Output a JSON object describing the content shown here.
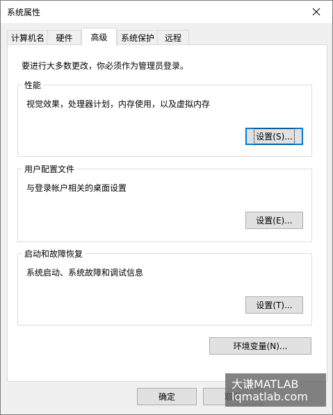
{
  "window": {
    "title": "系统属性"
  },
  "tabs": [
    {
      "label": "计算机名"
    },
    {
      "label": "硬件"
    },
    {
      "label": "高级"
    },
    {
      "label": "系统保护"
    },
    {
      "label": "远程"
    }
  ],
  "panel": {
    "intro": "要进行大多数更改，你必须作为管理员登录。",
    "performance": {
      "title": "性能",
      "desc": "视觉效果，处理器计划，内存使用，以及虚拟内存",
      "button": "设置(S)..."
    },
    "profiles": {
      "title": "用户配置文件",
      "desc": "与登录帐户相关的桌面设置",
      "button": "设置(E)..."
    },
    "startup": {
      "title": "启动和故障恢复",
      "desc": "系统启动、系统故障和调试信息",
      "button": "设置(T)..."
    },
    "env_button": "环境变量(N)..."
  },
  "footer": {
    "ok": "确定",
    "cancel": "取消"
  },
  "watermark": {
    "line1": "大谦MATLAB",
    "line2": "lqmatlab.com"
  },
  "icons": {
    "close": "close-icon"
  }
}
